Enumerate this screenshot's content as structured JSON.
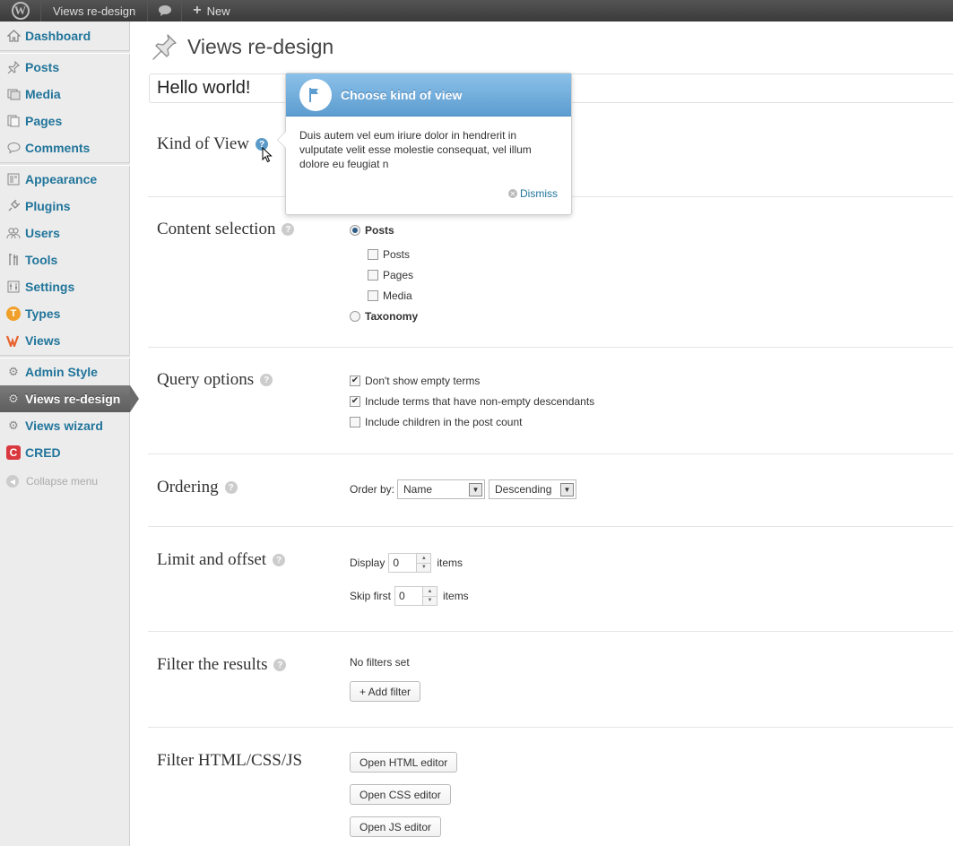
{
  "adminbar": {
    "site_name": "Views re-design",
    "new_label": "New",
    "logo_letter": "W"
  },
  "sidebar": {
    "items": [
      {
        "label": "Dashboard",
        "icon": "home-icon"
      },
      {
        "label": "Posts",
        "icon": "pin-icon"
      },
      {
        "label": "Media",
        "icon": "media-icon"
      },
      {
        "label": "Pages",
        "icon": "pages-icon"
      },
      {
        "label": "Comments",
        "icon": "comment-icon"
      },
      {
        "label": "Appearance",
        "icon": "appearance-icon"
      },
      {
        "label": "Plugins",
        "icon": "plugin-icon"
      },
      {
        "label": "Users",
        "icon": "users-icon"
      },
      {
        "label": "Tools",
        "icon": "tools-icon"
      },
      {
        "label": "Settings",
        "icon": "settings-icon"
      },
      {
        "label": "Types",
        "icon": "types-icon"
      },
      {
        "label": "Views",
        "icon": "views-icon"
      },
      {
        "label": "Admin Style",
        "icon": "gear-icon"
      },
      {
        "label": "Views re-design",
        "icon": "gear-icon",
        "current": true
      },
      {
        "label": "Views wizard",
        "icon": "gear-icon"
      },
      {
        "label": "CRED",
        "icon": "cred-icon"
      }
    ],
    "collapse_label": "Collapse menu"
  },
  "main": {
    "page_title": "Views re-design",
    "title_value": "Hello world!",
    "sections": {
      "kind": {
        "title": "Kind of View"
      },
      "content": {
        "title": "Content selection",
        "radio_posts": "Posts",
        "checkboxes": [
          "Posts",
          "Pages",
          "Media"
        ],
        "radio_taxonomy": "Taxonomy"
      },
      "query": {
        "title": "Query options",
        "options": [
          {
            "label": "Don't show empty terms",
            "checked": true
          },
          {
            "label": "Include terms that have non-empty descendants",
            "checked": true
          },
          {
            "label": "Include children in the post count",
            "checked": false
          }
        ]
      },
      "ordering": {
        "title": "Ordering",
        "order_by_label": "Order by:",
        "order_by_value": "Name",
        "direction_value": "Descending"
      },
      "limit": {
        "title": "Limit and offset",
        "display_label": "Display",
        "display_value": "0",
        "items_label": "items",
        "skip_label": "Skip first",
        "skip_value": "0",
        "items_label2": "items"
      },
      "filter": {
        "title": "Filter the results",
        "no_filters": "No filters set",
        "add_filter": "+ Add filter"
      },
      "editors": {
        "title": "Filter HTML/CSS/JS",
        "html_button": "Open HTML editor",
        "css_button": "Open CSS editor",
        "js_button": "Open JS editor"
      }
    }
  },
  "pointer": {
    "title": "Choose kind of view",
    "body": "Duis autem vel eum iriure dolor in hendrerit in vulputate velit esse molestie consequat, vel illum dolore eu feugiat n",
    "dismiss": "Dismiss"
  },
  "colors": {
    "link": "#21759b",
    "adminbar": "#464646",
    "pointer_header": "#6ea9d8"
  }
}
